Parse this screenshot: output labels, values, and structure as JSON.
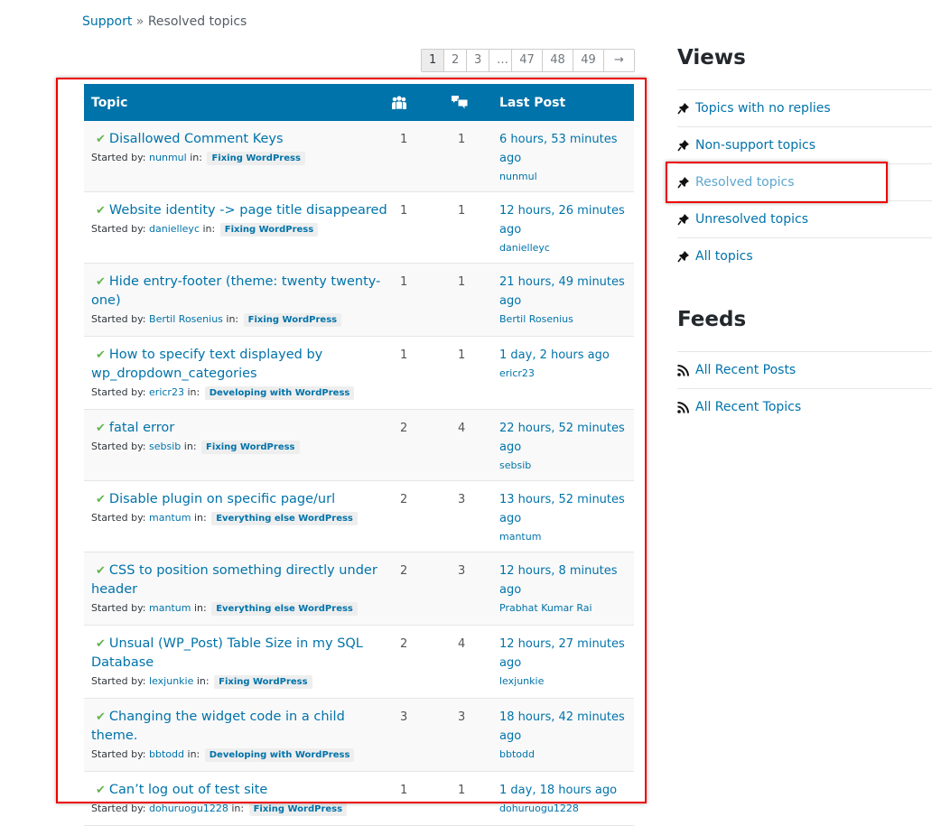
{
  "breadcrumb": {
    "root": "Support",
    "separator": "»",
    "current": "Resolved topics"
  },
  "pagination": {
    "pages": [
      "1",
      "2",
      "3",
      "…",
      "47",
      "48",
      "49"
    ],
    "next": "→",
    "current": "1"
  },
  "table": {
    "headers": {
      "topic": "Topic",
      "voices_icon": "voices-icon",
      "posts_icon": "posts-icon",
      "last_post": "Last Post"
    },
    "started_by_label": "Started by:",
    "in_label": "in:",
    "rows": [
      {
        "title": "Disallowed Comment Keys",
        "author": "nunmul",
        "forum": "Fixing WordPress",
        "voices": "1",
        "posts": "1",
        "last_post_time": "6 hours, 53 minutes ago",
        "last_post_user": "nunmul",
        "resolved": true
      },
      {
        "title": "Website identity -> page title disappeared",
        "author": "danielleyc",
        "forum": "Fixing WordPress",
        "voices": "1",
        "posts": "1",
        "last_post_time": "12 hours, 26 minutes ago",
        "last_post_user": "danielleyc",
        "resolved": true
      },
      {
        "title": "Hide entry-footer (theme: twenty twenty-one)",
        "author": "Bertil Rosenius",
        "forum": "Fixing WordPress",
        "voices": "1",
        "posts": "1",
        "last_post_time": "21 hours, 49 minutes ago",
        "last_post_user": "Bertil Rosenius",
        "resolved": true
      },
      {
        "title": "How to specify text displayed by wp_dropdown_categories",
        "author": "ericr23",
        "forum": "Developing with WordPress",
        "voices": "1",
        "posts": "1",
        "last_post_time": "1 day, 2 hours ago",
        "last_post_user": "ericr23",
        "resolved": true
      },
      {
        "title": "fatal error",
        "author": "sebsib",
        "forum": "Fixing WordPress",
        "voices": "2",
        "posts": "4",
        "last_post_time": "22 hours, 52 minutes ago",
        "last_post_user": "sebsib",
        "resolved": true
      },
      {
        "title": "Disable plugin on specific page/url",
        "author": "mantum",
        "forum": "Everything else WordPress",
        "voices": "2",
        "posts": "3",
        "last_post_time": "13 hours, 52 minutes ago",
        "last_post_user": "mantum",
        "resolved": true
      },
      {
        "title": "CSS to position something directly under header",
        "author": "mantum",
        "forum": "Everything else WordPress",
        "voices": "2",
        "posts": "3",
        "last_post_time": "12 hours, 8 minutes ago",
        "last_post_user": "Prabhat Kumar Rai",
        "resolved": true
      },
      {
        "title": "Unsual (WP_Post) Table Size in my SQL Database",
        "author": "lexjunkie",
        "forum": "Fixing WordPress",
        "voices": "2",
        "posts": "4",
        "last_post_time": "12 hours, 27 minutes ago",
        "last_post_user": "lexjunkie",
        "resolved": true
      },
      {
        "title": "Changing the widget code in a child theme.",
        "author": "bbtodd",
        "forum": "Developing with WordPress",
        "voices": "3",
        "posts": "3",
        "last_post_time": "18 hours, 42 minutes ago",
        "last_post_user": "bbtodd",
        "resolved": true
      },
      {
        "title": "Can’t log out of test site",
        "author": "dohuruogu1228",
        "forum": "Fixing WordPress",
        "voices": "1",
        "posts": "1",
        "last_post_time": "1 day, 18 hours ago",
        "last_post_user": "dohuruogu1228",
        "resolved": true
      }
    ]
  },
  "sidebar": {
    "views_title": "Views",
    "views": [
      {
        "label": "Topics with no replies",
        "icon": "pin-icon",
        "current": false
      },
      {
        "label": "Non-support topics",
        "icon": "pin-icon",
        "current": false
      },
      {
        "label": "Resolved topics",
        "icon": "pin-icon",
        "current": true
      },
      {
        "label": "Unresolved topics",
        "icon": "pin-icon",
        "current": false
      },
      {
        "label": "All topics",
        "icon": "pin-icon",
        "current": false
      }
    ],
    "feeds_title": "Feeds",
    "feeds": [
      {
        "label": "All Recent Posts",
        "icon": "rss-icon"
      },
      {
        "label": "All Recent Topics",
        "icon": "rss-icon"
      }
    ]
  },
  "colors": {
    "accent": "#0073aa",
    "check": "#64b450",
    "highlight": "#e00000"
  }
}
